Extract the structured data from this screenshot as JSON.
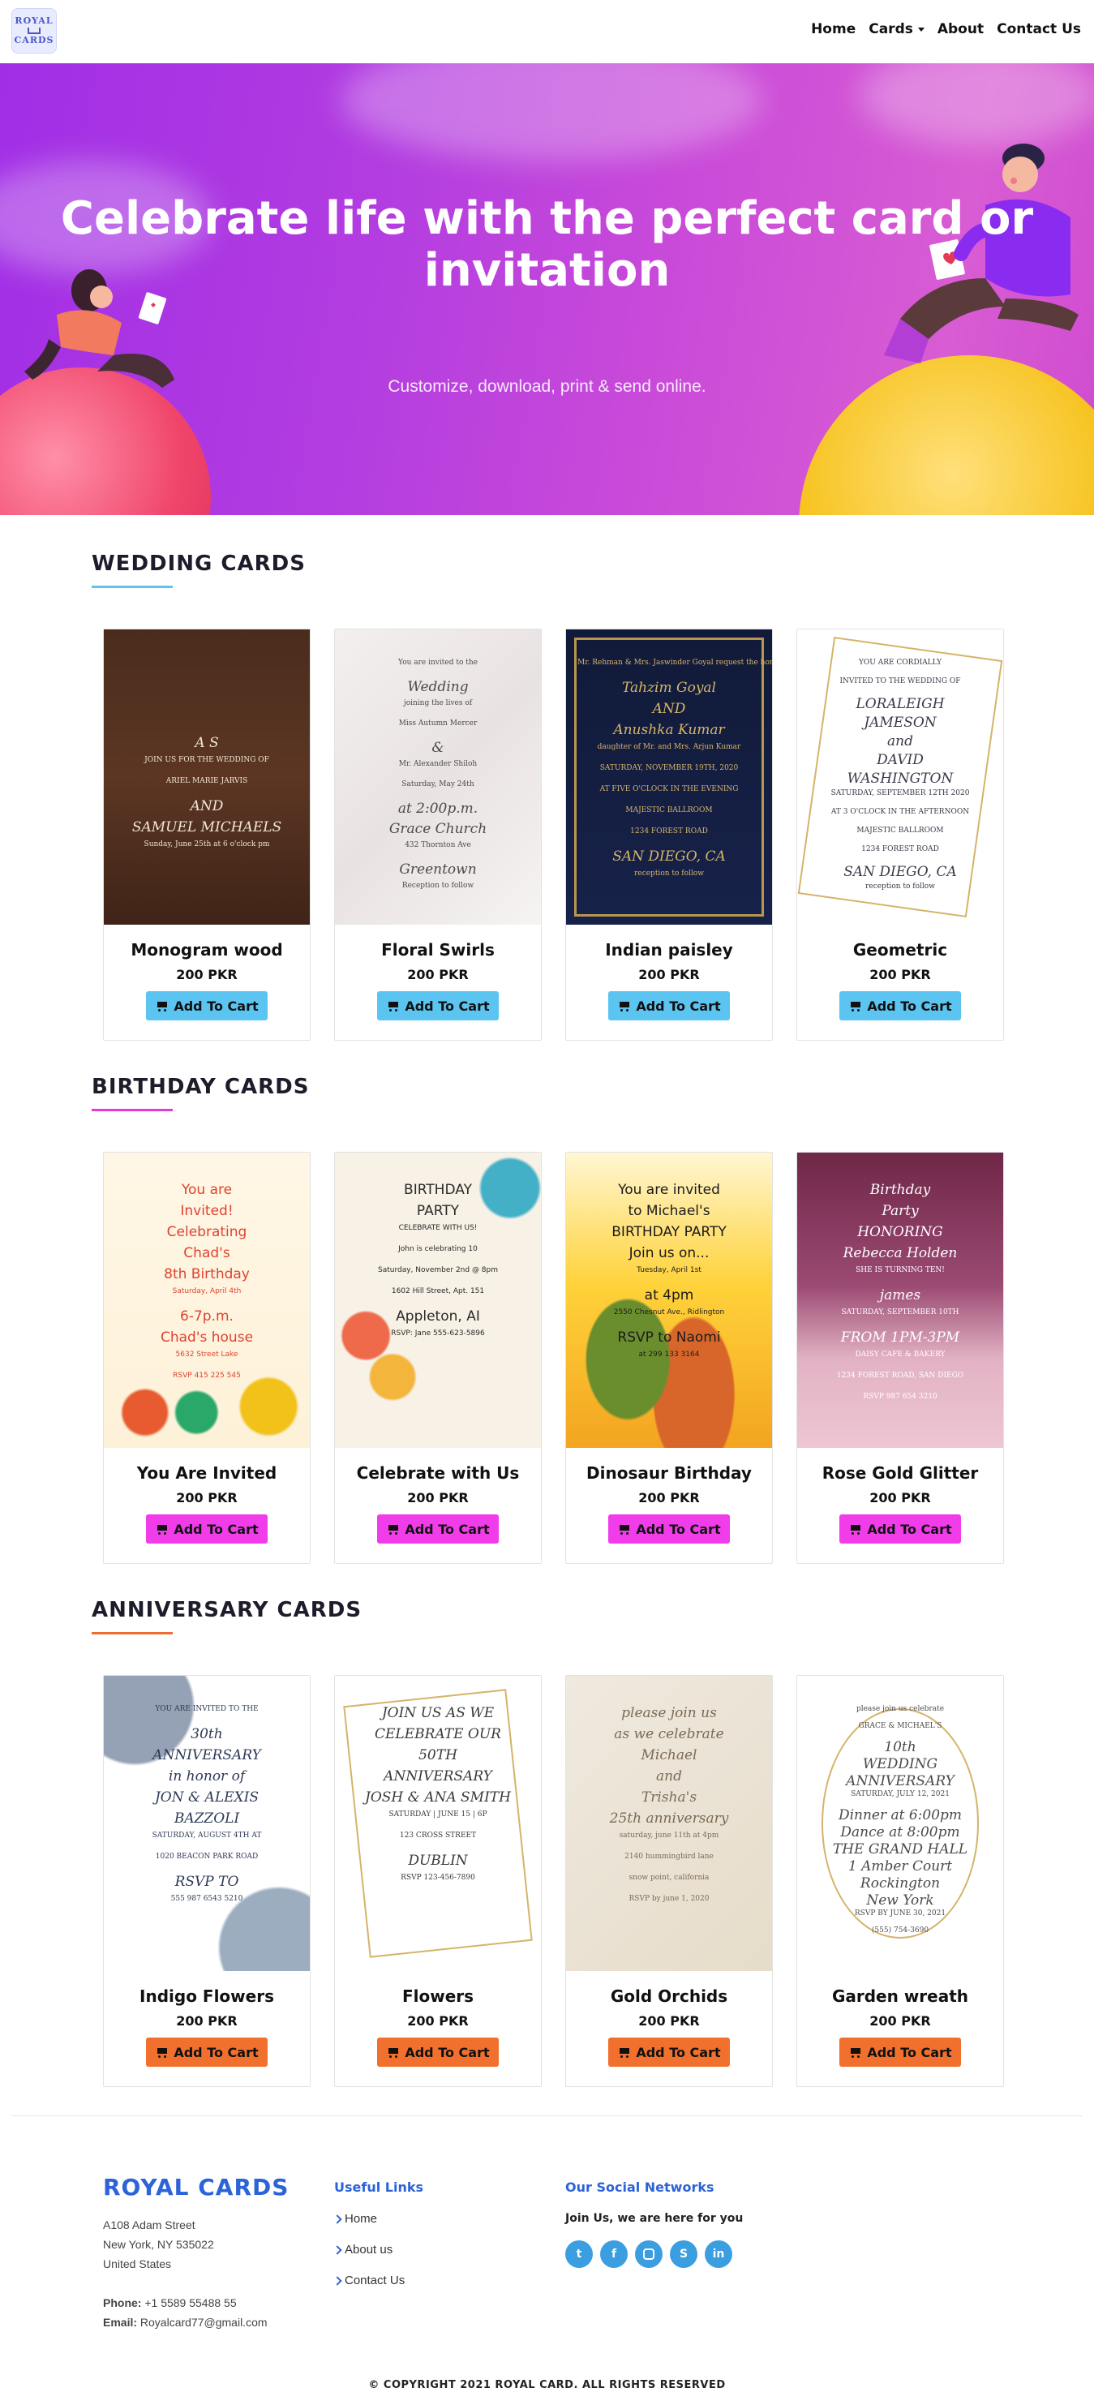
{
  "nav": {
    "logo_text": "ROYAL CARDS",
    "items": [
      {
        "label": "Home"
      },
      {
        "label": "Cards"
      },
      {
        "label": "About"
      },
      {
        "label": "Contact Us"
      }
    ]
  },
  "hero": {
    "title": "Celebrate life with the perfect card or invitation",
    "subtitle": "Customize, download, print & send online."
  },
  "sections": [
    {
      "title": "WEDDING CARDS",
      "accent": "#5bc4f0",
      "button_color": "#5bc4f0",
      "cards": [
        {
          "name": "Monogram wood",
          "price": "200 PKR",
          "button": "Add To Cart",
          "img_lines": [
            "A    S",
            "JOIN US FOR THE WEDDING OF",
            "ARIEL MARIE JARVIS",
            "AND",
            "SAMUEL MICHAELS",
            "Sunday, June 25th at 6 o'clock pm"
          ]
        },
        {
          "name": "Floral Swirls",
          "price": "200 PKR",
          "button": "Add To Cart",
          "img_lines": [
            "You are invited to the",
            "Wedding",
            "joining the lives of",
            "Miss Autumn Mercer",
            "&",
            "Mr. Alexander Shiloh",
            "Saturday, May 24th",
            "at 2:00p.m.",
            "Grace Church",
            "432 Thornton Ave",
            "Greentown",
            "Reception to follow"
          ]
        },
        {
          "name": "Indian paisley",
          "price": "200 PKR",
          "button": "Add To Cart",
          "img_lines": [
            "Mr. Rehman & Mrs. Jaswinder Goyal request the honor of your presence at the wedding of",
            "Tahzim Goyal",
            "AND",
            "Anushka Kumar",
            "daughter of Mr. and Mrs. Arjun Kumar",
            "SATURDAY, NOVEMBER 19TH, 2020",
            "AT FIVE O'CLOCK IN THE EVENING",
            "MAJESTIC BALLROOM",
            "1234 FOREST ROAD",
            "SAN DIEGO, CA",
            "reception to follow"
          ]
        },
        {
          "name": "Geometric",
          "price": "200 PKR",
          "button": "Add To Cart",
          "img_lines": [
            "YOU ARE CORDIALLY",
            "INVITED TO THE WEDDING OF",
            "LORALEIGH",
            "JAMESON",
            "and",
            "DAVID",
            "WASHINGTON",
            "SATURDAY, SEPTEMBER 12TH 2020",
            "AT 3 O'CLOCK IN THE AFTERNOON",
            "MAJESTIC BALLROOM",
            "1234 FOREST ROAD",
            "SAN DIEGO, CA",
            "reception to follow"
          ]
        }
      ]
    },
    {
      "title": "BIRTHDAY CARDS",
      "accent": "#e43ad6",
      "button_color": "#f03de9",
      "cards": [
        {
          "name": "You Are Invited",
          "price": "200 PKR",
          "button": "Add To Cart",
          "img_lines": [
            "You are",
            "Invited!",
            "Celebrating",
            "Chad's",
            "8th Birthday",
            "Saturday, April 4th",
            "6-7p.m.",
            "Chad's house",
            "5632 Street Lake",
            "RSVP 415 225 545"
          ]
        },
        {
          "name": "Celebrate with Us",
          "price": "200 PKR",
          "button": "Add To Cart",
          "img_lines": [
            "BIRTHDAY",
            "PARTY",
            "CELEBRATE WITH US!",
            "John is celebrating 10",
            "Saturday, November 2nd @ 8pm",
            "1602 Hill Street, Apt. 151",
            "Appleton, AI",
            "RSVP: Jane 555-623-5896"
          ]
        },
        {
          "name": "Dinosaur Birthday",
          "price": "200 PKR",
          "button": "Add To Cart",
          "img_lines": [
            "You are invited",
            "to Michael's",
            "BIRTHDAY PARTY",
            "Join us on...",
            "Tuesday, April 1st",
            "at 4pm",
            "2550 Chesnut Ave., Ridlington",
            "RSVP to Naomi",
            "at 299 133 3164"
          ]
        },
        {
          "name": "Rose Gold Glitter",
          "price": "200 PKR",
          "button": "Add To Cart",
          "img_lines": [
            "Birthday",
            "Party",
            "HONORING",
            "Rebecca Holden",
            "SHE IS TURNING TEN!",
            "james",
            "SATURDAY, SEPTEMBER 10TH",
            "FROM 1PM-3PM",
            "DAISY CAFE & BAKERY",
            "1234 FOREST ROAD, SAN DIEGO",
            "RSVP 987 654 3210"
          ]
        }
      ]
    },
    {
      "title": "ANNIVERSARY CARDS",
      "accent": "#f06c2f",
      "button_color": "#f2702d",
      "cards": [
        {
          "name": "Indigo Flowers",
          "price": "200 PKR",
          "button": "Add To Cart",
          "img_lines": [
            "YOU ARE INVITED TO THE",
            "30th",
            "ANNIVERSARY",
            "in honor of",
            "JON & ALEXIS",
            "BAZZOLI",
            "SATURDAY, AUGUST 4TH AT",
            "1020 BEACON PARK ROAD",
            "RSVP TO",
            "555 987 6543 5210"
          ]
        },
        {
          "name": "Flowers",
          "price": "200 PKR",
          "button": "Add To Cart",
          "img_lines": [
            "JOIN US AS WE",
            "CELEBRATE OUR",
            "50TH",
            "ANNIVERSARY",
            "JOSH & ANA SMITH",
            "SATURDAY | JUNE 15 | 6P",
            "123 CROSS STREET",
            "DUBLIN",
            "RSVP 123-456-7890"
          ]
        },
        {
          "name": "Gold Orchids",
          "price": "200 PKR",
          "button": "Add To Cart",
          "img_lines": [
            "please join us",
            "as we celebrate",
            "Michael",
            "and",
            "Trisha's",
            "25th anniversary",
            "saturday, june 11th at 4pm",
            "2140 hummingbird lane",
            "snow point, california",
            "RSVP by june 1, 2020"
          ]
        },
        {
          "name": "Garden wreath",
          "price": "200 PKR",
          "button": "Add To Cart",
          "img_lines": [
            "please join us celebrate",
            "GRACE & MICHAEL'S",
            "10th",
            "WEDDING",
            "ANNIVERSARY",
            "SATURDAY, JULY 12, 2021",
            "Dinner at 6:00pm",
            "Dance at 8:00pm",
            "THE GRAND HALL",
            "1 Amber Court",
            "Rockington",
            "New York",
            "RSVP BY JUNE 30, 2021",
            "(555) 754-3690"
          ]
        }
      ]
    }
  ],
  "footer": {
    "brand": "ROYAL CARDS",
    "address": [
      "A108 Adam Street",
      "New York, NY 535022",
      "United States"
    ],
    "phone_label": "Phone:",
    "phone": "+1 5589 55488 55",
    "email_label": "Email:",
    "email": "Royalcard77@gmail.com",
    "links_title": "Useful Links",
    "links": [
      "Home",
      "About us",
      "Contact Us"
    ],
    "social_title": "Our Social Networks",
    "social_text": "Join Us, we are here for you",
    "social_icons": [
      "twitter-icon",
      "facebook-icon",
      "instagram-icon",
      "skype-icon",
      "linkedin-icon"
    ],
    "copyright": "© COPYRIGHT 2021 ROYAL CARD. ALL RIGHTS RESERVED"
  }
}
